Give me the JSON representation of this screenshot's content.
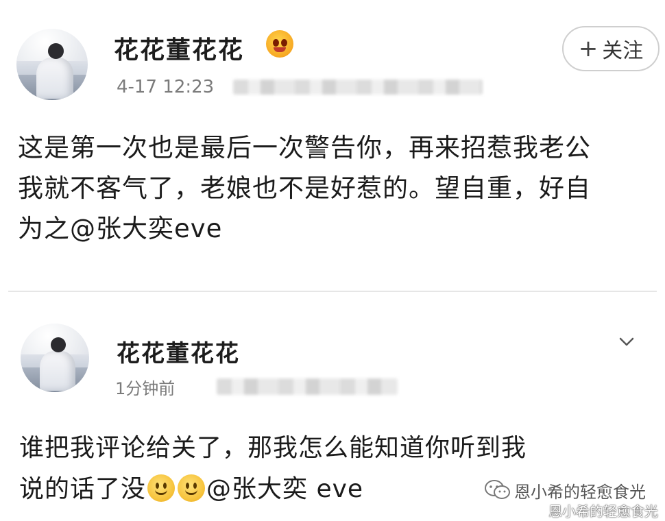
{
  "posts": [
    {
      "username": "花花董花花",
      "timestamp": "4-17 12:23",
      "follow_label": "关注",
      "text_lines": [
        "这是第一次也是最后一次警告你，再来招惹我老公",
        "我就不客气了，老娘也不是好惹的。望自重，好自",
        "为之@张大奕eve"
      ]
    },
    {
      "username": "花花董花花",
      "timestamp": "1分钟前",
      "text_line_1": "谁把我评论给关了，那我怎么能知道你听到我",
      "text_line_2_prefix": "说的话了没",
      "text_line_2_mention": "@张大奕 eve"
    }
  ],
  "watermark": {
    "text": "恩小希的轻愈食光",
    "text_shadow": "恩小希的轻愈食光"
  },
  "icons": {
    "badge": "laughing-emoji-icon",
    "smiley": "smiley-emoji-icon",
    "chevron": "chevron-down-icon",
    "watermark": "wechat-icon"
  },
  "colors": {
    "text": "#1b1b1b",
    "meta": "#7b7b7b",
    "follow_border": "#cfcfcf"
  }
}
